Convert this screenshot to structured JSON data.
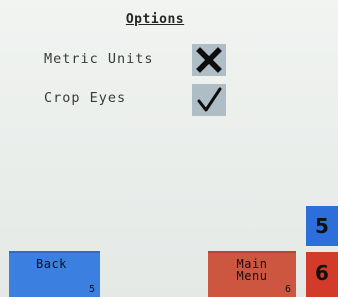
{
  "title": "Options",
  "options": [
    {
      "label": "Metric Units",
      "state": "x-mark",
      "icon": "x-mark-icon"
    },
    {
      "label": "Crop Eyes",
      "state": "checked",
      "icon": "checkmark-icon"
    }
  ],
  "buttons": {
    "back": {
      "label": "Back",
      "key": "5"
    },
    "main_menu": {
      "label": "Main\nMenu",
      "key": "6"
    }
  },
  "side_keys": [
    "5",
    "6"
  ],
  "colors": {
    "background": "#ecf0ed",
    "checkbox": "#aebdc6",
    "blue": "#3b7fe0",
    "red": "#cd5640"
  }
}
